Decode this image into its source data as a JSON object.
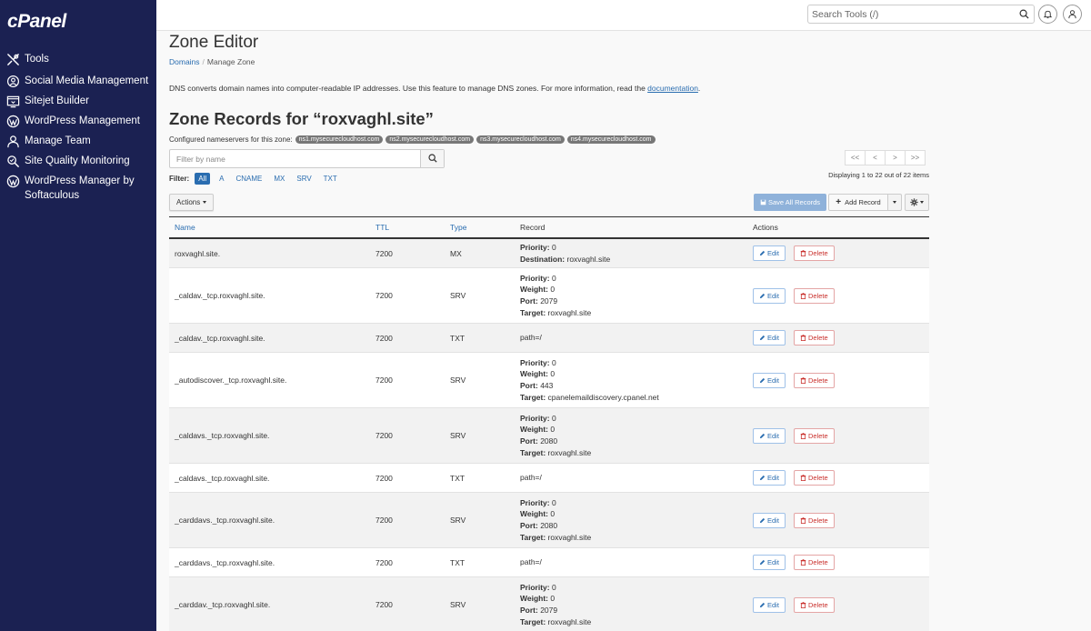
{
  "app": {
    "logo": "cPanel"
  },
  "sidebar": {
    "items": [
      {
        "label": "Tools",
        "icon": "tools-icon"
      },
      {
        "label": "Social Media Management",
        "icon": "social-media-icon"
      },
      {
        "label": "Sitejet Builder",
        "icon": "sitejet-icon"
      },
      {
        "label": "WordPress Management",
        "icon": "wordpress-icon"
      },
      {
        "label": "Manage Team",
        "icon": "team-icon"
      },
      {
        "label": "Site Quality Monitoring",
        "icon": "quality-monitoring-icon"
      },
      {
        "label": "WordPress Manager by Softaculous",
        "icon": "wordpress-icon"
      }
    ]
  },
  "topbar": {
    "search_placeholder": "Search Tools (/)"
  },
  "page": {
    "title": "Zone Editor",
    "breadcrumb": {
      "root": "Domains",
      "sep": "/",
      "current": "Manage Zone"
    },
    "intro_text": "DNS converts domain names into computer-readable IP addresses. Use this feature to manage DNS zones. For more information, read the ",
    "intro_link": "documentation",
    "intro_end": ".",
    "zone_title": "Zone Records for “roxvaghl.site”",
    "ns_label": "Configured nameservers for this zone:",
    "nameservers": [
      "ns1.mysecurecloudhost.com",
      "ns2.mysecurecloudhost.com",
      "ns3.mysecurecloudhost.com",
      "ns4.mysecurecloudhost.com"
    ],
    "filter_placeholder": "Filter by name",
    "filter_label": "Filter:",
    "filter_options": [
      "All",
      "A",
      "CNAME",
      "MX",
      "SRV",
      "TXT"
    ],
    "pager": [
      "<<",
      "<",
      ">",
      ">>"
    ],
    "display_info": "Displaying 1 to 22 out of 22 items",
    "actions_label": "Actions",
    "save_all_label": "Save All Records",
    "add_record_label": "Add Record"
  },
  "table": {
    "headers": {
      "name": "Name",
      "ttl": "TTL",
      "type": "Type",
      "record": "Record",
      "actions": "Actions"
    },
    "edit_label": "Edit",
    "delete_label": "Delete",
    "rows": [
      {
        "name": "roxvaghl.site.",
        "ttl": "7200",
        "type": "MX",
        "height": 32,
        "record": [
          {
            "k": "Priority:",
            "v": " 0"
          },
          {
            "k": "Destination:",
            "v": " roxvaghl.site"
          }
        ]
      },
      {
        "name": "_caldav._tcp.roxvaghl.site.",
        "ttl": "7200",
        "type": "SRV",
        "height": 61,
        "record": [
          {
            "k": "Priority:",
            "v": " 0"
          },
          {
            "k": "Weight:",
            "v": " 0"
          },
          {
            "k": "Port:",
            "v": " 2079"
          },
          {
            "k": "Target:",
            "v": " roxvaghl.site"
          }
        ]
      },
      {
        "name": "_caldav._tcp.roxvaghl.site.",
        "ttl": "7200",
        "type": "TXT",
        "height": 32,
        "record": [
          {
            "k": "",
            "v": "path=/"
          }
        ]
      },
      {
        "name": "_autodiscover._tcp.roxvaghl.site.",
        "ttl": "7200",
        "type": "SRV",
        "height": 61,
        "record": [
          {
            "k": "Priority:",
            "v": " 0"
          },
          {
            "k": "Weight:",
            "v": " 0"
          },
          {
            "k": "Port:",
            "v": " 443"
          },
          {
            "k": "Target:",
            "v": " cpanelemaildiscovery.cpanel.net"
          }
        ]
      },
      {
        "name": "_caldavs._tcp.roxvaghl.site.",
        "ttl": "7200",
        "type": "SRV",
        "height": 61,
        "record": [
          {
            "k": "Priority:",
            "v": " 0"
          },
          {
            "k": "Weight:",
            "v": " 0"
          },
          {
            "k": "Port:",
            "v": " 2080"
          },
          {
            "k": "Target:",
            "v": " roxvaghl.site"
          }
        ]
      },
      {
        "name": "_caldavs._tcp.roxvaghl.site.",
        "ttl": "7200",
        "type": "TXT",
        "height": 32,
        "record": [
          {
            "k": "",
            "v": "path=/"
          }
        ]
      },
      {
        "name": "_carddavs._tcp.roxvaghl.site.",
        "ttl": "7200",
        "type": "SRV",
        "height": 61,
        "record": [
          {
            "k": "Priority:",
            "v": " 0"
          },
          {
            "k": "Weight:",
            "v": " 0"
          },
          {
            "k": "Port:",
            "v": " 2080"
          },
          {
            "k": "Target:",
            "v": " roxvaghl.site"
          }
        ]
      },
      {
        "name": "_carddavs._tcp.roxvaghl.site.",
        "ttl": "7200",
        "type": "TXT",
        "height": 32,
        "record": [
          {
            "k": "",
            "v": "path=/"
          }
        ]
      },
      {
        "name": "_carddav._tcp.roxvaghl.site.",
        "ttl": "7200",
        "type": "SRV",
        "height": 61,
        "record": [
          {
            "k": "Priority:",
            "v": " 0"
          },
          {
            "k": "Weight:",
            "v": " 0"
          },
          {
            "k": "Port:",
            "v": " 2079"
          },
          {
            "k": "Target:",
            "v": " roxvaghl.site"
          }
        ]
      }
    ]
  },
  "colors": {
    "sidebar_bg": "#1b2152",
    "link": "#2a6db0",
    "delete": "#c9302c",
    "save_disabled": "#8fb2da"
  }
}
